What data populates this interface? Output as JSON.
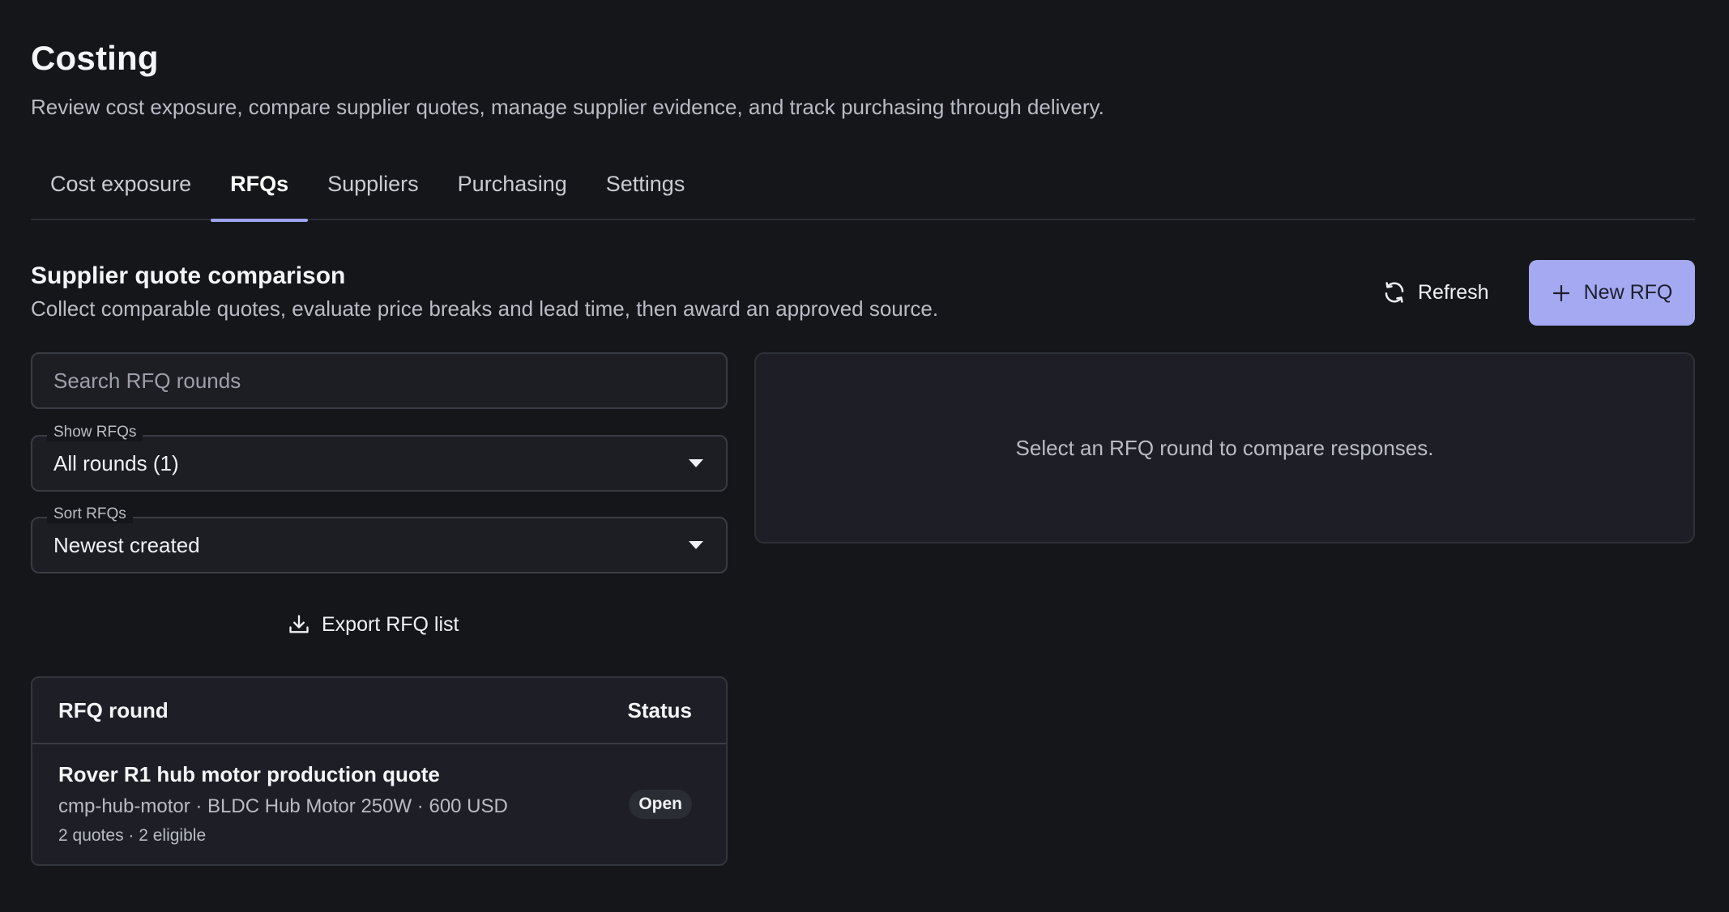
{
  "page": {
    "title": "Costing",
    "subtitle": "Review cost exposure, compare supplier quotes, manage supplier evidence, and track purchasing through delivery."
  },
  "tabs": [
    {
      "label": "Cost exposure",
      "active": false
    },
    {
      "label": "RFQs",
      "active": true
    },
    {
      "label": "Suppliers",
      "active": false
    },
    {
      "label": "Purchasing",
      "active": false
    },
    {
      "label": "Settings",
      "active": false
    }
  ],
  "section": {
    "title": "Supplier quote comparison",
    "subtitle": "Collect comparable quotes, evaluate price breaks and lead time, then award an approved source."
  },
  "actions": {
    "refresh_label": "Refresh",
    "refresh_icon": "refresh-icon",
    "new_rfq_label": "New RFQ",
    "new_rfq_icon": "plus-icon",
    "export_label": "Export RFQ list",
    "export_icon": "download-icon"
  },
  "search": {
    "placeholder": "Search RFQ rounds",
    "value": ""
  },
  "filters": {
    "show": {
      "label": "Show RFQs",
      "value": "All rounds (1)"
    },
    "sort": {
      "label": "Sort RFQs",
      "value": "Newest created"
    }
  },
  "table": {
    "columns": [
      "RFQ round",
      "Status"
    ],
    "rows": [
      {
        "title": "Rover R1 hub motor production quote",
        "detail": "cmp-hub-motor · BLDC Hub Motor 250W · 600 USD",
        "meta": "2 quotes · 2 eligible",
        "status": "Open"
      }
    ]
  },
  "compare_panel": {
    "empty_text": "Select an RFQ round to compare responses."
  },
  "colors": {
    "background": "#15161a",
    "accent": "#a5a9f2",
    "tab_indicator": "#9ea3f0"
  }
}
